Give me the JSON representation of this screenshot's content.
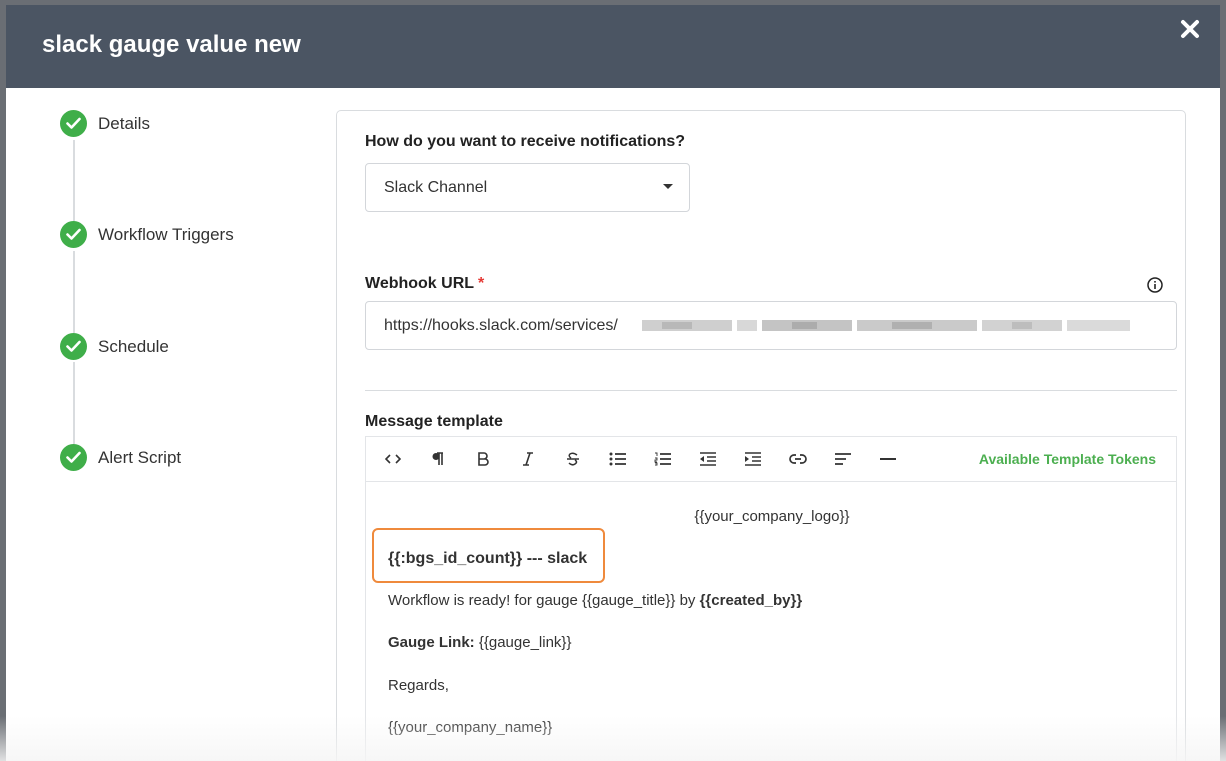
{
  "modal": {
    "title": "slack gauge value new"
  },
  "stepper": {
    "steps": [
      {
        "label": "Details"
      },
      {
        "label": "Workflow Triggers"
      },
      {
        "label": "Schedule"
      },
      {
        "label": "Alert Script"
      }
    ]
  },
  "form": {
    "notify_question": "How do you want to receive notifications?",
    "notify_selected": "Slack Channel",
    "webhook_label": "Webhook URL",
    "webhook_required": "*",
    "webhook_value": "https://hooks.slack.com/services/",
    "template_label": "Message template",
    "tokens_link": "Available Template Tokens"
  },
  "toolbar": {
    "buttons": [
      "code-icon",
      "paragraph-icon",
      "bold-icon",
      "italic-icon",
      "strikethrough-icon",
      "bullet-list-icon",
      "numbered-list-icon",
      "outdent-icon",
      "indent-icon",
      "link-icon",
      "align-left-icon",
      "horizontal-rule-icon"
    ]
  },
  "editor": {
    "logo_token": "{{your_company_logo}}",
    "header_line": "{{:bgs_id_count}} --- slack",
    "workflow_prefix": "Workflow is ready! for gauge {{gauge_title}} by ",
    "workflow_bold": "{{created_by}}",
    "gauge_link_label": "Gauge Link:",
    "gauge_link_value": " {{gauge_link}}",
    "regards": "Regards,",
    "company_name": "{{your_company_name}}"
  },
  "colors": {
    "header_bg": "#4b5563",
    "success_green": "#3fae49",
    "highlight_orange": "#ef8a3c",
    "tokens_green": "#4caf50",
    "required_red": "#e53935"
  }
}
